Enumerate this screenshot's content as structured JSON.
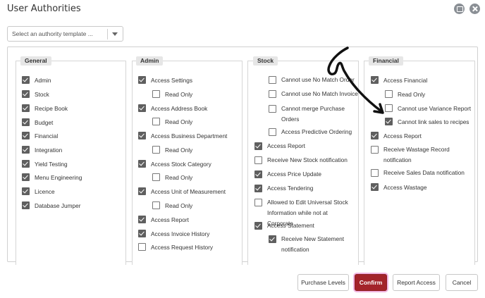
{
  "window": {
    "title": "User Authorities"
  },
  "template_select": {
    "placeholder": "Select an authority template ..."
  },
  "sections": {
    "general": {
      "title": "General",
      "items": [
        {
          "label": "Admin",
          "checked": true
        },
        {
          "label": "Stock",
          "checked": true
        },
        {
          "label": "Recipe Book",
          "checked": true
        },
        {
          "label": "Budget",
          "checked": true
        },
        {
          "label": "Financial",
          "checked": true
        },
        {
          "label": "Integration",
          "checked": true
        },
        {
          "label": "Yield Testing",
          "checked": true
        },
        {
          "label": "Menu Engineering",
          "checked": true
        },
        {
          "label": "Licence",
          "checked": true
        },
        {
          "label": "Database Jumper",
          "checked": true
        }
      ]
    },
    "admin": {
      "title": "Admin",
      "items": [
        {
          "label": "Access Settings",
          "checked": true
        },
        {
          "label": "Read Only",
          "checked": false
        },
        {
          "label": "Access Address Book",
          "checked": true
        },
        {
          "label": "Read Only",
          "checked": false
        },
        {
          "label": "Access Business Department",
          "checked": true
        },
        {
          "label": "Read Only",
          "checked": false
        },
        {
          "label": "Access Stock Category",
          "checked": true
        },
        {
          "label": "Read Only",
          "checked": false
        },
        {
          "label": "Access Unit of Measurement",
          "checked": true
        },
        {
          "label": "Read Only",
          "checked": false
        },
        {
          "label": "Access Report",
          "checked": true
        },
        {
          "label": "Access Invoice History",
          "checked": true
        },
        {
          "label": "Access Request History",
          "checked": false
        }
      ]
    },
    "stock": {
      "title": "Stock",
      "items": [
        {
          "label": "Cannot use No Match Order",
          "checked": false
        },
        {
          "label": "Cannot use No Match Invoice",
          "checked": false
        },
        {
          "label": "Cannot merge Purchase Orders",
          "checked": false
        },
        {
          "label": "Access Predictive Ordering",
          "checked": false
        },
        {
          "label": "Access Report",
          "checked": true
        },
        {
          "label": "Receive New Stock notification",
          "checked": false
        },
        {
          "label": "Access Price Update",
          "checked": true
        },
        {
          "label": "Access Tendering",
          "checked": true
        },
        {
          "label": "Allowed to Edit Universal Stock Information while not at Corporate",
          "checked": false
        },
        {
          "label": "Access Statement",
          "checked": true
        },
        {
          "label": "Receive New Statement notification",
          "checked": true
        }
      ]
    },
    "financial": {
      "title": "Financial",
      "items": [
        {
          "label": "Access Financial",
          "checked": true
        },
        {
          "label": "Read Only",
          "checked": false
        },
        {
          "label": "Cannot use Variance Report",
          "checked": false
        },
        {
          "label": "Cannot link sales to recipes",
          "checked": true
        },
        {
          "label": "Access Report",
          "checked": true
        },
        {
          "label": "Receive Wastage Record notification",
          "checked": false
        },
        {
          "label": "Receive Sales Data notification",
          "checked": false
        },
        {
          "label": "Access Wastage",
          "checked": true
        }
      ]
    }
  },
  "buttons": {
    "purchase_levels": "Purchase Levels",
    "confirm": "Confirm",
    "report_access": "Report Access",
    "cancel": "Cancel"
  },
  "colors": {
    "confirm_bg": "#a3232a",
    "checkbox_checked": "#5f5f5f",
    "highlight": "#f1b5e1"
  }
}
